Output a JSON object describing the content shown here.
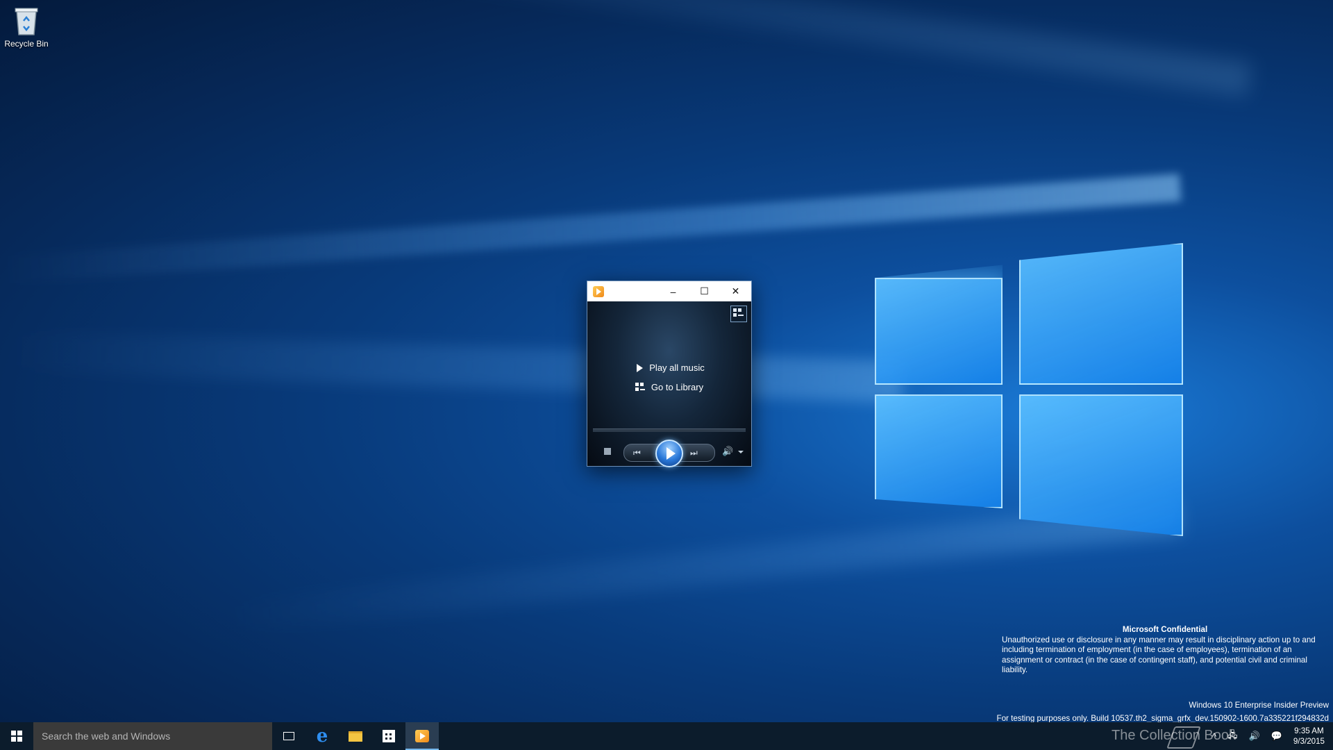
{
  "desktop": {
    "icons": [
      {
        "label": "Recycle Bin",
        "icon": "recycle-bin-icon"
      }
    ]
  },
  "player": {
    "app_icon": "windows-media-player-icon",
    "title_buttons": {
      "minimize": "–",
      "maximize": "☐",
      "close": "✕"
    },
    "actions": [
      {
        "label": "Play all music",
        "icon": "play-icon"
      },
      {
        "label": "Go to Library",
        "icon": "library-icon"
      }
    ],
    "controls": {
      "stop": "stop-icon",
      "previous": "⏮",
      "play": "play-icon",
      "next": "⏭",
      "volume": "🔊"
    }
  },
  "watermark": {
    "title": "Microsoft Confidential",
    "body": "Unauthorized use or disclosure in any manner may result in disciplinary action up to and including termination of employment (in the case of employees), termination of an assignment or contract (in the case of contingent staff), and potential civil and criminal liability.",
    "edition": "Windows 10 Enterprise Insider Preview",
    "build": "For testing purposes only. Build 10537.th2_sigma_grfx_dev.150902-1600.7a335221f294832d"
  },
  "taskbar": {
    "search_placeholder": "Search the web and Windows",
    "pinned": [
      "task-view-icon",
      "edge-icon",
      "file-explorer-icon",
      "store-icon",
      "windows-media-player-icon"
    ],
    "tray": {
      "chevron": "^",
      "network": "🖧",
      "volume": "🔊",
      "notifications": "💬"
    },
    "time": "9:35 AM",
    "date": "9/3/2015",
    "overlay_text": "The Collection Book"
  },
  "colors": {
    "accent": "#76b9ed",
    "taskbar": "#0c1c2c"
  }
}
